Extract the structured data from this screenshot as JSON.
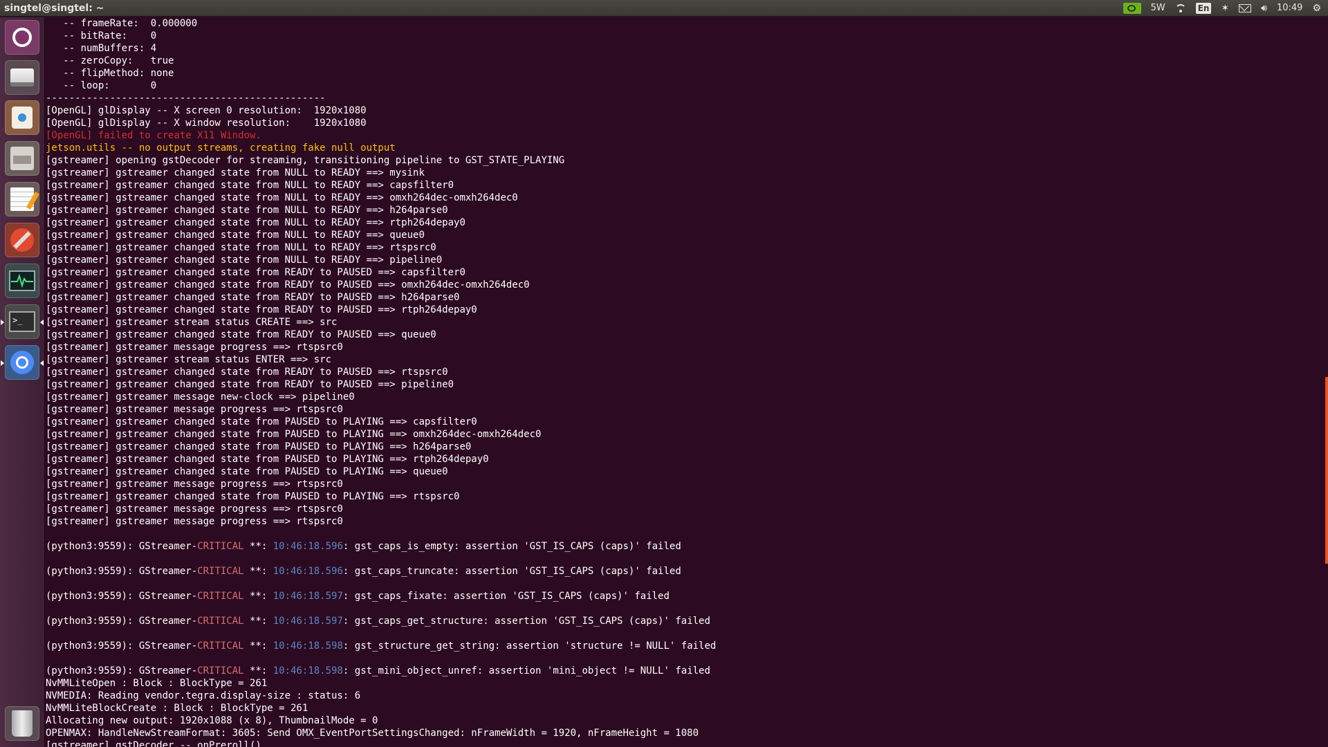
{
  "topbar": {
    "title": "singtel@singtel: ~",
    "power": "5W",
    "keyboard_layout": "En",
    "clock": "10:49"
  },
  "launcher": {
    "items": [
      {
        "name": "Dash",
        "icon": "ubuntu-logo-icon"
      },
      {
        "name": "Files",
        "icon": "drive-icon"
      },
      {
        "name": "Software",
        "icon": "shopping-bag-icon"
      },
      {
        "name": "File cabinet",
        "icon": "cabinet-icon"
      },
      {
        "name": "Text Editor",
        "icon": "notepad-icon"
      },
      {
        "name": "System Settings",
        "icon": "settings-tools-icon"
      },
      {
        "name": "System Monitor",
        "icon": "system-monitor-icon"
      },
      {
        "name": "Terminal",
        "icon": "terminal-icon"
      },
      {
        "name": "Chromium",
        "icon": "chromium-icon"
      },
      {
        "name": "Trash",
        "icon": "trash-icon"
      }
    ]
  },
  "colors": {
    "terminal_bg": "#2c0a22",
    "error_red": "#d32f2f",
    "warning_yellow": "#ffc107",
    "timestamp_blue": "#5b88c2",
    "accent_orange": "#e95420"
  },
  "terminal": {
    "lines": [
      "   -- frameRate:  0.000000",
      "   -- bitRate:    0",
      "   -- numBuffers: 4",
      "   -- zeroCopy:   true",
      "   -- flipMethod: none",
      "   -- loop:       0",
      "------------------------------------------------",
      "[OpenGL] glDisplay -- X screen 0 resolution:  1920x1080",
      "[OpenGL] glDisplay -- X window resolution:    1920x1080",
      "[OpenGL] failed to create X11 Window.",
      "jetson.utils -- no output streams, creating fake null output",
      "[gstreamer] opening gstDecoder for streaming, transitioning pipeline to GST_STATE_PLAYING",
      "[gstreamer] gstreamer changed state from NULL to READY ==> mysink",
      "[gstreamer] gstreamer changed state from NULL to READY ==> capsfilter0",
      "[gstreamer] gstreamer changed state from NULL to READY ==> omxh264dec-omxh264dec0",
      "[gstreamer] gstreamer changed state from NULL to READY ==> h264parse0",
      "[gstreamer] gstreamer changed state from NULL to READY ==> rtph264depay0",
      "[gstreamer] gstreamer changed state from NULL to READY ==> queue0",
      "[gstreamer] gstreamer changed state from NULL to READY ==> rtspsrc0",
      "[gstreamer] gstreamer changed state from NULL to READY ==> pipeline0",
      "[gstreamer] gstreamer changed state from READY to PAUSED ==> capsfilter0",
      "[gstreamer] gstreamer changed state from READY to PAUSED ==> omxh264dec-omxh264dec0",
      "[gstreamer] gstreamer changed state from READY to PAUSED ==> h264parse0",
      "[gstreamer] gstreamer changed state from READY to PAUSED ==> rtph264depay0",
      "[gstreamer] gstreamer stream status CREATE ==> src",
      "[gstreamer] gstreamer changed state from READY to PAUSED ==> queue0",
      "[gstreamer] gstreamer message progress ==> rtspsrc0",
      "[gstreamer] gstreamer stream status ENTER ==> src",
      "[gstreamer] gstreamer changed state from READY to PAUSED ==> rtspsrc0",
      "[gstreamer] gstreamer changed state from READY to PAUSED ==> pipeline0",
      "[gstreamer] gstreamer message new-clock ==> pipeline0",
      "[gstreamer] gstreamer message progress ==> rtspsrc0",
      "[gstreamer] gstreamer changed state from PAUSED to PLAYING ==> capsfilter0",
      "[gstreamer] gstreamer changed state from PAUSED to PLAYING ==> omxh264dec-omxh264dec0",
      "[gstreamer] gstreamer changed state from PAUSED to PLAYING ==> h264parse0",
      "[gstreamer] gstreamer changed state from PAUSED to PLAYING ==> rtph264depay0",
      "[gstreamer] gstreamer changed state from PAUSED to PLAYING ==> queue0",
      "[gstreamer] gstreamer message progress ==> rtspsrc0",
      "[gstreamer] gstreamer changed state from PAUSED to PLAYING ==> rtspsrc0",
      "[gstreamer] gstreamer message progress ==> rtspsrc0",
      "[gstreamer] gstreamer message progress ==> rtspsrc0",
      "",
      "(python3:9559): GStreamer-CRITICAL **: 10:46:18.596: gst_caps_is_empty: assertion 'GST_IS_CAPS (caps)' failed",
      "",
      "(python3:9559): GStreamer-CRITICAL **: 10:46:18.596: gst_caps_truncate: assertion 'GST_IS_CAPS (caps)' failed",
      "",
      "(python3:9559): GStreamer-CRITICAL **: 10:46:18.597: gst_caps_fixate: assertion 'GST_IS_CAPS (caps)' failed",
      "",
      "(python3:9559): GStreamer-CRITICAL **: 10:46:18.597: gst_caps_get_structure: assertion 'GST_IS_CAPS (caps)' failed",
      "",
      "(python3:9559): GStreamer-CRITICAL **: 10:46:18.598: gst_structure_get_string: assertion 'structure != NULL' failed",
      "",
      "(python3:9559): GStreamer-CRITICAL **: 10:46:18.598: gst_mini_object_unref: assertion 'mini_object != NULL' failed",
      "NvMMLiteOpen : Block : BlockType = 261",
      "NVMEDIA: Reading vendor.tegra.display-size : status: 6",
      "NvMMLiteBlockCreate : Block : BlockType = 261",
      "Allocating new output: 1920x1088 (x 8), ThumbnailMode = 0",
      "OPENMAX: HandleNewStreamFormat: 3605: Send OMX_EventPortSettingsChanged: nFrameWidth = 1920, nFrameHeight = 1080",
      "[gstreamer] gstDecoder -- onPreroll()"
    ]
  }
}
